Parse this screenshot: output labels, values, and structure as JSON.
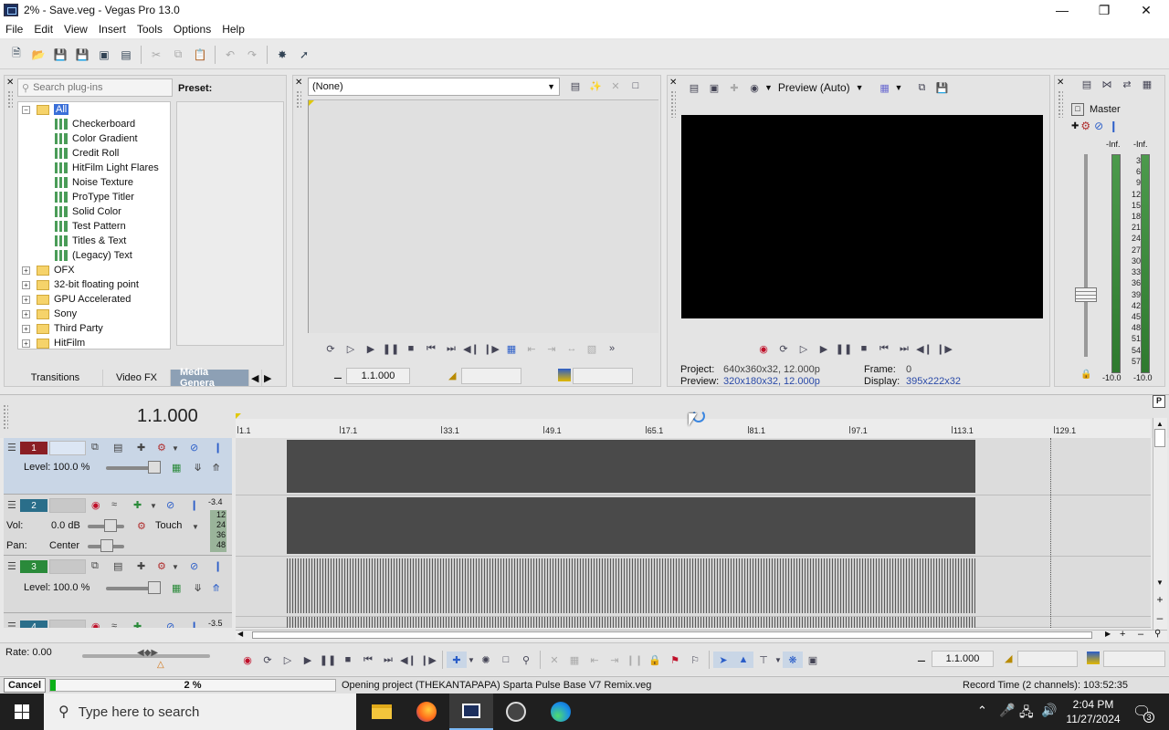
{
  "window": {
    "title": "2% - Save.veg - Vegas Pro 13.0"
  },
  "menu": [
    "File",
    "Edit",
    "View",
    "Insert",
    "Tools",
    "Options",
    "Help"
  ],
  "plugins": {
    "search_placeholder": "Search plug-ins",
    "preset_label": "Preset:",
    "tree": [
      {
        "label": "All",
        "level": 0,
        "type": "folder",
        "expanded": true,
        "selected": true
      },
      {
        "label": "Checkerboard",
        "level": 1,
        "type": "fx"
      },
      {
        "label": "Color Gradient",
        "level": 1,
        "type": "fx"
      },
      {
        "label": "Credit Roll",
        "level": 1,
        "type": "fx"
      },
      {
        "label": "HitFilm Light Flares",
        "level": 1,
        "type": "fx"
      },
      {
        "label": "Noise Texture",
        "level": 1,
        "type": "fx"
      },
      {
        "label": "ProType Titler",
        "level": 1,
        "type": "fx"
      },
      {
        "label": "Solid Color",
        "level": 1,
        "type": "fx"
      },
      {
        "label": "Test Pattern",
        "level": 1,
        "type": "fx"
      },
      {
        "label": "Titles & Text",
        "level": 1,
        "type": "fx"
      },
      {
        "label": "(Legacy) Text",
        "level": 1,
        "type": "fx"
      },
      {
        "label": "OFX",
        "level": 0,
        "type": "folder"
      },
      {
        "label": "32-bit floating point",
        "level": 0,
        "type": "folder"
      },
      {
        "label": "GPU Accelerated",
        "level": 0,
        "type": "folder"
      },
      {
        "label": "Sony",
        "level": 0,
        "type": "folder"
      },
      {
        "label": "Third Party",
        "level": 0,
        "type": "folder"
      },
      {
        "label": "HitFilm",
        "level": 0,
        "type": "folder"
      }
    ],
    "tabs": [
      "Transitions",
      "Video FX",
      "Media Genera"
    ]
  },
  "trimmer": {
    "select_value": "(None)",
    "time": "1.1.000"
  },
  "preview": {
    "mode": "Preview (Auto)",
    "project_label": "Project:",
    "project_value": "640x360x32, 12.000p",
    "preview_label": "Preview:",
    "preview_value": "320x180x32, 12.000p",
    "frame_label": "Frame:",
    "frame_value": "0",
    "display_label": "Display:",
    "display_value": "395x222x32"
  },
  "master": {
    "title": "Master",
    "peak_left": "-Inf.",
    "peak_right": "-Inf.",
    "scale": [
      "3",
      "6",
      "9",
      "12",
      "15",
      "18",
      "21",
      "24",
      "27",
      "30",
      "33",
      "36",
      "39",
      "42",
      "45",
      "48",
      "51",
      "54",
      "57"
    ],
    "bottom_left": "-10.0",
    "bottom_right": "-10.0"
  },
  "timeline": {
    "cursor_time": "1.1.000",
    "ruler": [
      "1.1",
      "17.1",
      "33.1",
      "49.1",
      "65.1",
      "81.1",
      "97.1",
      "113.1",
      "129.1"
    ]
  },
  "tracks": [
    {
      "number": "1",
      "kind": "video",
      "level_label": "Level:",
      "level_value": "100.0 %"
    },
    {
      "number": "2",
      "kind": "audio",
      "vol_label": "Vol:",
      "vol_value": "0.0 dB",
      "pan_label": "Pan:",
      "pan_value": "Center",
      "automation": "Touch",
      "meter_top": "-3.4",
      "meter_scale": [
        "12",
        "24",
        "36",
        "48"
      ]
    },
    {
      "number": "3",
      "kind": "video",
      "level_label": "Level:",
      "level_value": "100.0 %"
    },
    {
      "number": "4",
      "kind": "audio",
      "meter_top": "-3.5"
    }
  ],
  "transport": {
    "rate_label": "Rate: 0.00",
    "time": "1.1.000"
  },
  "status": {
    "cancel_label": "Cancel",
    "progress_text": "2 %",
    "progress_percent": 2,
    "message": "Opening project (THEKANTAPAPA) Sparta Pulse Base V7 Remix.veg",
    "record_time": "Record Time (2 channels): 103:52:35"
  },
  "taskbar": {
    "search_placeholder": "Type here to search",
    "time": "2:04 PM",
    "date": "11/27/2024",
    "notification_count": "3"
  },
  "colors": {
    "track1": "#8a1e24",
    "track2": "#2a6e8a",
    "track3": "#2a8a3a",
    "progress": "#0cb018"
  }
}
